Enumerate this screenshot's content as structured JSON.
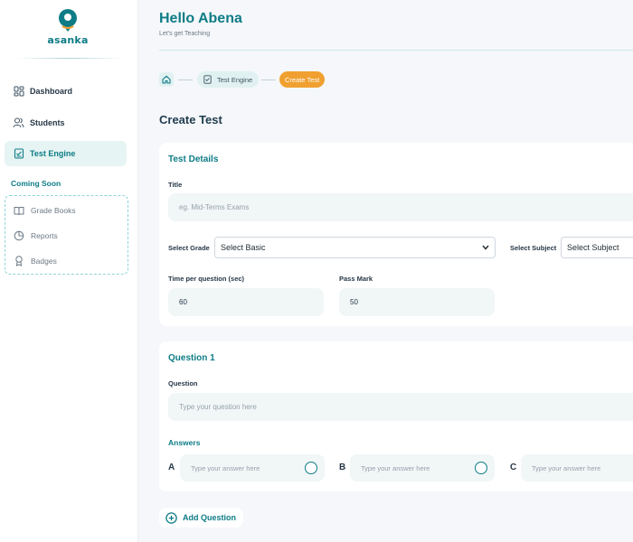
{
  "brand": {
    "name": "asanka",
    "color": "#0e7c86",
    "accent": "#f0a030"
  },
  "sidebar": {
    "items": [
      {
        "label": "Dashboard",
        "icon": "grid-icon"
      },
      {
        "label": "Students",
        "icon": "users-icon"
      },
      {
        "label": "Test Engine",
        "icon": "clipboard-icon",
        "active": true
      }
    ],
    "coming_soon_label": "Coming Soon",
    "coming_soon_items": [
      {
        "label": "Grade Books",
        "icon": "book-open-icon"
      },
      {
        "label": "Reports",
        "icon": "pie-chart-icon"
      },
      {
        "label": "Badges",
        "icon": "award-icon"
      }
    ]
  },
  "header": {
    "greeting": "Hello Abena",
    "subtitle": "Let's get Teaching"
  },
  "breadcrumb": {
    "home_icon": "home-icon",
    "items": [
      "Test Engine",
      "Create Test"
    ]
  },
  "page": {
    "title": "Create Test"
  },
  "test_details": {
    "title": "Test Details",
    "title_label": "Title",
    "title_placeholder": "eg. Mid-Terms Exams",
    "grade_label": "Select Grade",
    "grade_value": "Select Basic",
    "subject_label": "Select Subject",
    "subject_value": "Select Subject",
    "time_label": "Time per question (sec)",
    "time_value": "60",
    "pass_label": "Pass Mark",
    "pass_value": "50"
  },
  "question": {
    "title": "Question 1",
    "question_label": "Question",
    "question_placeholder": "Type your question here",
    "answers_label": "Answers",
    "answers": [
      {
        "letter": "A",
        "placeholder": "Type your answer here"
      },
      {
        "letter": "B",
        "placeholder": "Type your answer here"
      },
      {
        "letter": "C",
        "placeholder": "Type your answer here"
      }
    ]
  },
  "add_question_label": "Add Question"
}
